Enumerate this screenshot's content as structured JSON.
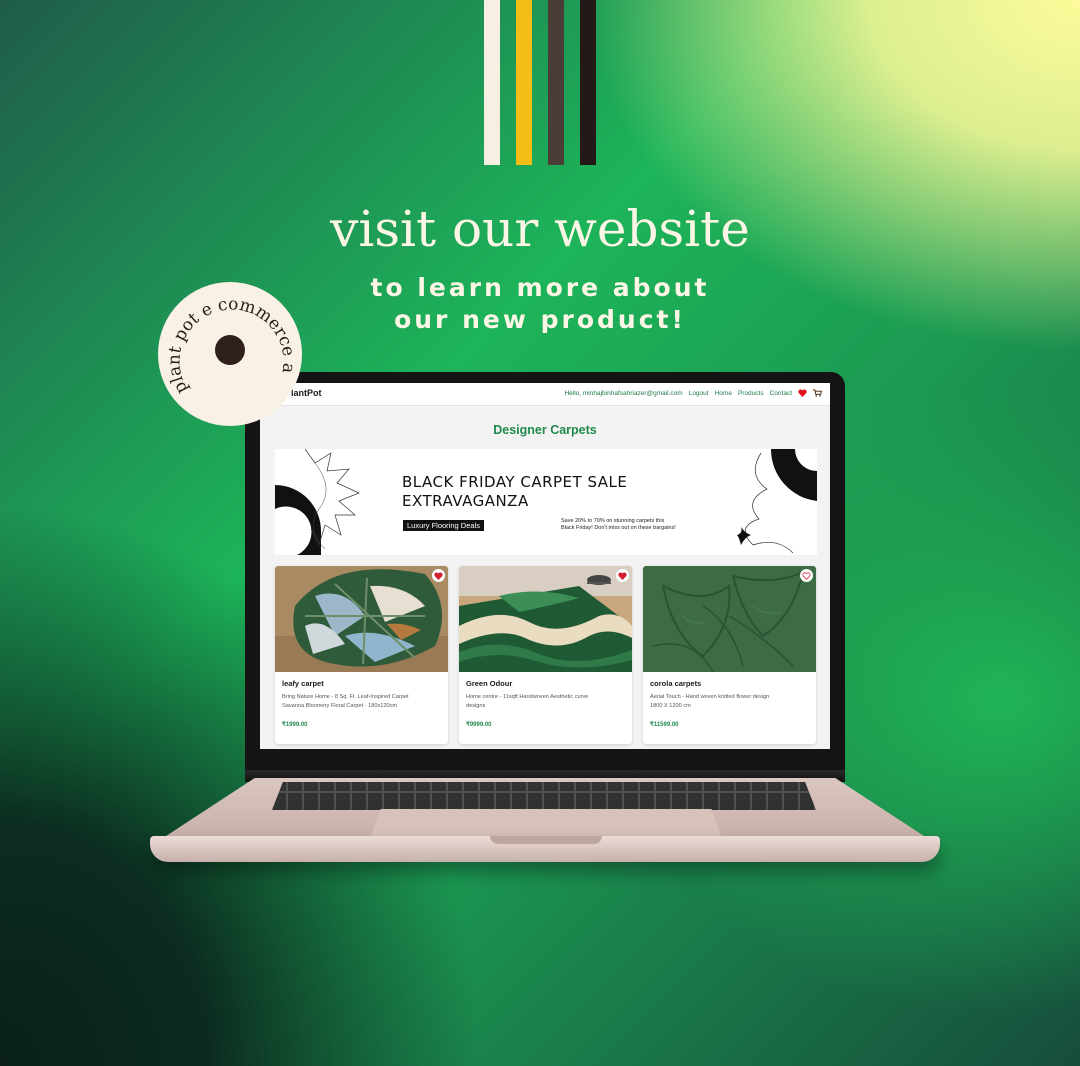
{
  "promo": {
    "headline": "visit our website",
    "subline_1": "to learn more about",
    "subline_2": "our new product!",
    "badge_text": "plant pot e commerce app",
    "stripe_colors": [
      "#f6efe2",
      "#f5bd18",
      "#4a3c36",
      "#231a17"
    ]
  },
  "nav": {
    "brand": "PlantPot",
    "greeting": "Hello, minhajbinhafsahriazer@gmail.com",
    "links": [
      "Logout",
      "Home",
      "Products",
      "Contact"
    ],
    "icons": [
      "heart-icon",
      "cart-icon"
    ]
  },
  "page": {
    "title": "Designer Carpets"
  },
  "banner": {
    "title_line_1": "BLACK FRIDAY CARPET SALE",
    "title_line_2": "EXTRAVAGANZA",
    "tag": "Luxury Flooring Deals",
    "note_line_1": "Save 20% to 70% on stunning carpets this",
    "note_line_2": "Black Friday! Don't miss out on these bargains!"
  },
  "products": [
    {
      "name": "leafy carpet",
      "desc_1": "Bring Nature Home - 8 Sq. Ft. Leaf-Inspired Carpet",
      "desc_2": "Savanna Bloomery Floral Carpet - 180x120cm",
      "price": "₹1999.00",
      "favorited": true
    },
    {
      "name": "Green Odour",
      "desc_1": "Home centre - 11sqft Handwoven Aesthetic curve",
      "desc_2": "designs",
      "price": "₹9999.00",
      "favorited": true
    },
    {
      "name": "corola carpets",
      "desc_1": "Aerial Touch - Hand woven knitted flower design",
      "desc_2": "1800 X 1200 cm",
      "price": "₹11599.00",
      "favorited": false
    }
  ],
  "colors": {
    "accent_green": "#1f8a4c",
    "heart_red": "#d32030",
    "cream": "#fdf6e6"
  }
}
